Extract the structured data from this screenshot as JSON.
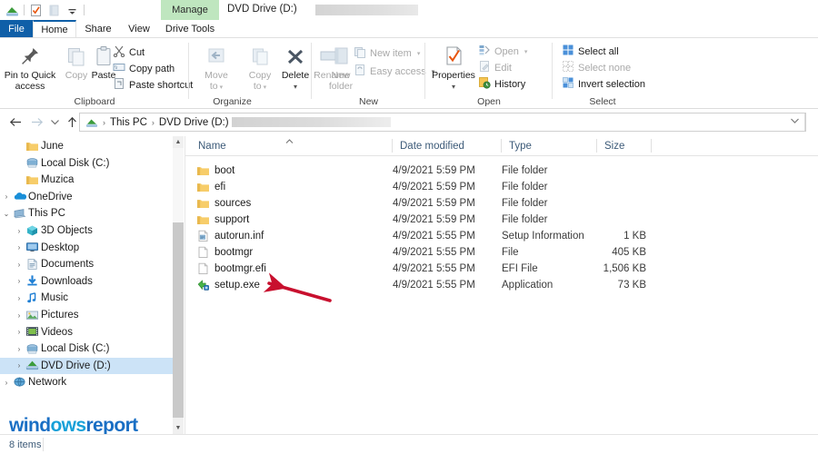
{
  "window": {
    "title": "DVD Drive (D:)",
    "quick_access_icons": [
      "drive-icon",
      "properties-check-icon",
      "new-folder-icon",
      "customize-caret-icon"
    ],
    "context_tab_group": "Manage",
    "context_tab": "Drive Tools"
  },
  "tabs": [
    {
      "label": "File",
      "name": "tab-file"
    },
    {
      "label": "Home",
      "name": "tab-home"
    },
    {
      "label": "Share",
      "name": "tab-share"
    },
    {
      "label": "View",
      "name": "tab-view"
    },
    {
      "label": "Drive Tools",
      "name": "tab-drive-tools"
    }
  ],
  "ribbon": {
    "groups": [
      {
        "label": "Clipboard"
      },
      {
        "label": "Organize"
      },
      {
        "label": "New"
      },
      {
        "label": "Open"
      },
      {
        "label": "Select"
      }
    ],
    "clipboard": {
      "pin_to_quick_access": "Pin to Quick\naccess",
      "pin_line1": "Pin to Quick",
      "pin_line2": "access",
      "copy": "Copy",
      "paste": "Paste",
      "cut": "Cut",
      "copy_path": "Copy path",
      "paste_shortcut": "Paste shortcut"
    },
    "organize": {
      "move_to_line1": "Move",
      "move_to_line2": "to",
      "copy_to_line1": "Copy",
      "copy_to_line2": "to",
      "delete": "Delete",
      "rename": "Rename"
    },
    "new_group": {
      "new_folder_line1": "New",
      "new_folder_line2": "folder",
      "new_item": "New item",
      "easy_access": "Easy access"
    },
    "open_group": {
      "properties": "Properties",
      "open": "Open",
      "edit": "Edit",
      "history": "History"
    },
    "select_group": {
      "select_all": "Select all",
      "select_none": "Select none",
      "invert_selection": "Invert selection"
    }
  },
  "address_bar": {
    "back": "back-arrow-icon",
    "forward": "forward-arrow-icon",
    "recent": "recent-locations-caret-icon",
    "up": "up-arrow-icon",
    "breadcrumbs": [
      "This PC",
      "DVD Drive (D:)"
    ],
    "separator": "›",
    "dropdown": "address-dropdown-caret-icon"
  },
  "nav_pane": {
    "items": [
      {
        "label": "June",
        "icon": "folder-icon",
        "indent": 1,
        "expander": "",
        "selected": false
      },
      {
        "label": "Local Disk (C:)",
        "icon": "disk-icon",
        "indent": 1,
        "expander": "",
        "selected": false
      },
      {
        "label": "Muzica",
        "icon": "folder-icon",
        "indent": 1,
        "expander": "",
        "selected": false
      },
      {
        "label": "OneDrive",
        "icon": "onedrive-icon",
        "indent": 0,
        "expander": "›",
        "selected": false
      },
      {
        "label": "This PC",
        "icon": "this-pc-icon",
        "indent": 0,
        "expander": "⌄",
        "selected": false
      },
      {
        "label": "3D Objects",
        "icon": "3d-objects-icon",
        "indent": 1,
        "expander": "›",
        "selected": false
      },
      {
        "label": "Desktop",
        "icon": "desktop-icon",
        "indent": 1,
        "expander": "›",
        "selected": false
      },
      {
        "label": "Documents",
        "icon": "documents-icon",
        "indent": 1,
        "expander": "›",
        "selected": false
      },
      {
        "label": "Downloads",
        "icon": "downloads-icon",
        "indent": 1,
        "expander": "›",
        "selected": false
      },
      {
        "label": "Music",
        "icon": "music-icon",
        "indent": 1,
        "expander": "›",
        "selected": false
      },
      {
        "label": "Pictures",
        "icon": "pictures-icon",
        "indent": 1,
        "expander": "›",
        "selected": false
      },
      {
        "label": "Videos",
        "icon": "videos-icon",
        "indent": 1,
        "expander": "›",
        "selected": false
      },
      {
        "label": "Local Disk (C:)",
        "icon": "disk-icon",
        "indent": 1,
        "expander": "›",
        "selected": false
      },
      {
        "label": "DVD Drive (D:)",
        "icon": "dvd-drive-icon",
        "indent": 1,
        "expander": "›",
        "selected": true
      },
      {
        "label": "Network",
        "icon": "network-icon",
        "indent": 0,
        "expander": "›",
        "selected": false
      }
    ]
  },
  "file_list": {
    "columns": [
      {
        "label": "Name",
        "name": "column-name"
      },
      {
        "label": "Date modified",
        "name": "column-date-modified"
      },
      {
        "label": "Type",
        "name": "column-type"
      },
      {
        "label": "Size",
        "name": "column-size"
      }
    ],
    "sorted_by": "Name",
    "rows": [
      {
        "name": "boot",
        "date": "4/9/2021 5:59 PM",
        "type": "File folder",
        "size": "",
        "icon": "folder-icon"
      },
      {
        "name": "efi",
        "date": "4/9/2021 5:59 PM",
        "type": "File folder",
        "size": "",
        "icon": "folder-icon"
      },
      {
        "name": "sources",
        "date": "4/9/2021 5:59 PM",
        "type": "File folder",
        "size": "",
        "icon": "folder-icon"
      },
      {
        "name": "support",
        "date": "4/9/2021 5:59 PM",
        "type": "File folder",
        "size": "",
        "icon": "folder-icon"
      },
      {
        "name": "autorun.inf",
        "date": "4/9/2021 5:55 PM",
        "type": "Setup Information",
        "size": "1 KB",
        "icon": "setup-info-icon"
      },
      {
        "name": "bootmgr",
        "date": "4/9/2021 5:55 PM",
        "type": "File",
        "size": "405 KB",
        "icon": "generic-file-icon"
      },
      {
        "name": "bootmgr.efi",
        "date": "4/9/2021 5:55 PM",
        "type": "EFI File",
        "size": "1,506 KB",
        "icon": "generic-file-icon"
      },
      {
        "name": "setup.exe",
        "date": "4/9/2021 5:55 PM",
        "type": "Application",
        "size": "73 KB",
        "icon": "setup-exe-icon"
      }
    ]
  },
  "status_bar": {
    "item_count": "8 items"
  },
  "annotation": {
    "arrow_color": "#c8102e",
    "points_at": "setup.exe"
  },
  "watermark": {
    "part1": "wind",
    "part2": "ows",
    "part3": "report"
  },
  "colors": {
    "accent": "#0f5fa8",
    "context_tab": "#bfe6bf",
    "selection": "#cce3f7",
    "folder": "#f7cd6a",
    "header_text": "#3c5a78"
  }
}
